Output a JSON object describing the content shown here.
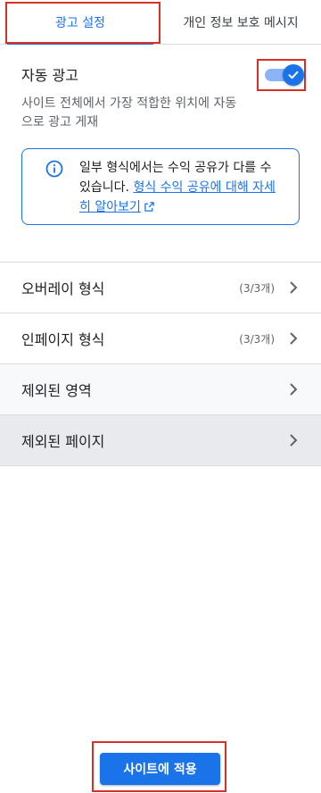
{
  "tabs": [
    {
      "label": "광고 설정",
      "active": true
    },
    {
      "label": "개인 정보 보호 메시지",
      "active": false
    }
  ],
  "auto_ads": {
    "title": "자동 광고",
    "description": "사이트 전체에서 가장 적합한 위치에 자동으로 광고 게재",
    "toggle_on": true
  },
  "info": {
    "text": "일부 형식에서는 수익 공유가 다를 수 있습니다.",
    "link": "형식 수익 공유에 대해 자세히 알아보기",
    "icon": "info-icon"
  },
  "list": [
    {
      "label": "오버레이 형식",
      "count": "(3/3개)"
    },
    {
      "label": "인페이지 형식",
      "count": "(3/3개)"
    },
    {
      "label": "제외된 영역",
      "count": ""
    },
    {
      "label": "제외된 페이지",
      "count": ""
    }
  ],
  "apply_button": "사이트에 적용",
  "colors": {
    "accent": "#1a73e8",
    "highlight": "#d93025"
  }
}
